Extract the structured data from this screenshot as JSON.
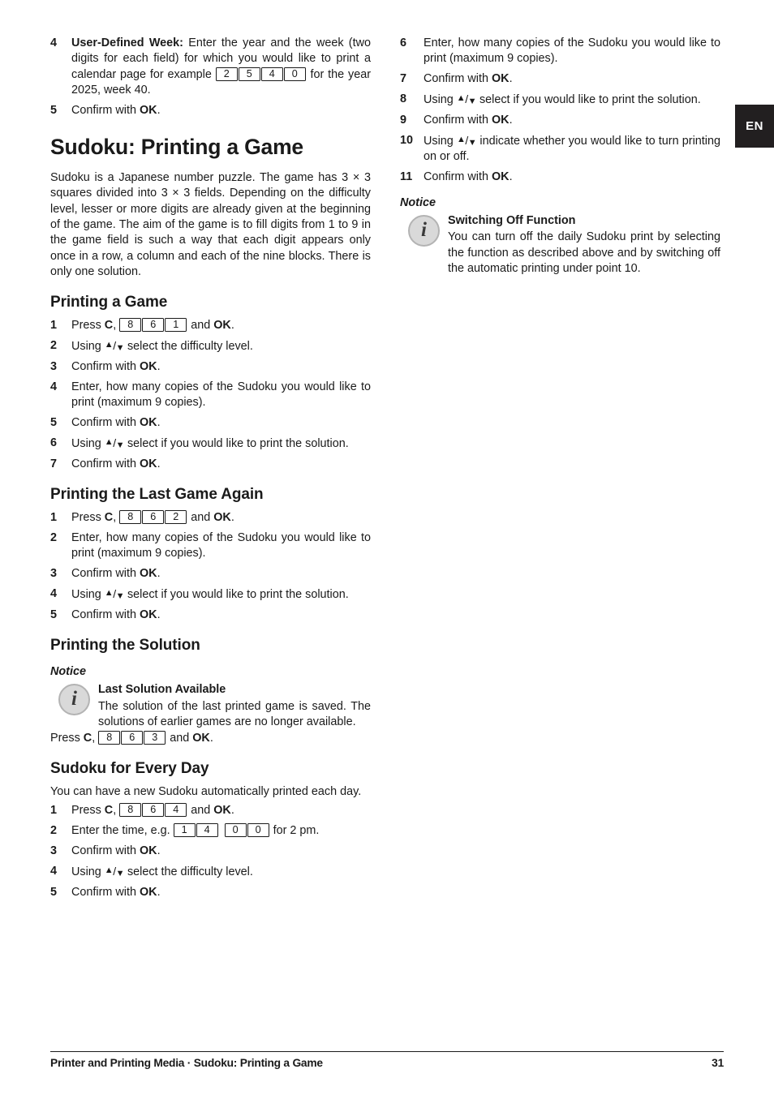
{
  "language_tab": {
    "label": "EN"
  },
  "left_column": {
    "continued_steps": [
      {
        "num": "4",
        "lead": "User-Defined Week:",
        "text_before": " Enter the year and the week (two digits for each field) for which you would like to print a calendar page for example ",
        "keys": [
          "2",
          "5",
          "4",
          "0"
        ],
        "text_after": " for the year 2025, week 40."
      },
      {
        "num": "5",
        "text_before": "Confirm with ",
        "bold": "OK",
        "text_after": "."
      }
    ],
    "section_title": "Sudoku: Printing a Game",
    "intro": "Sudoku is a Japanese number puzzle. The game has 3 × 3 squares divided into 3 × 3 fields. Depending on the difficulty level, lesser or more digits are already given at the beginning of the game. The aim of the game is to fill digits from 1 to 9 in the game field is such a way that each digit appears only once in a row, a column and each of the nine blocks. There is only one solution.",
    "printing_a_game": {
      "title": "Printing a Game",
      "steps": [
        {
          "num": "1",
          "kind": "press",
          "text_before": "Press ",
          "key_c": "C",
          "comma": ", ",
          "keys": [
            "8",
            "6",
            "1"
          ],
          "mid": " and ",
          "bold": "OK",
          "text_after": "."
        },
        {
          "num": "2",
          "kind": "updown",
          "text_before": "Using ",
          "text_after": " select the difficulty level."
        },
        {
          "num": "3",
          "kind": "confirm",
          "text_before": "Confirm with ",
          "bold": "OK",
          "text_after": "."
        },
        {
          "num": "4",
          "kind": "plain",
          "text": "Enter, how many copies of the Sudoku you would like to print (maximum 9 copies)."
        },
        {
          "num": "5",
          "kind": "confirm",
          "text_before": "Confirm with ",
          "bold": "OK",
          "text_after": "."
        },
        {
          "num": "6",
          "kind": "updown",
          "text_before": "Using ",
          "text_after": " select if you would like to print the solution."
        },
        {
          "num": "7",
          "kind": "confirm",
          "text_before": "Confirm with ",
          "bold": "OK",
          "text_after": "."
        }
      ]
    },
    "printing_last_game": {
      "title": "Printing the Last Game Again",
      "steps": [
        {
          "num": "1",
          "kind": "press",
          "text_before": "Press ",
          "key_c": "C",
          "comma": ", ",
          "keys": [
            "8",
            "6",
            "2"
          ],
          "mid": " and ",
          "bold": "OK",
          "text_after": "."
        },
        {
          "num": "2",
          "kind": "plain",
          "text": "Enter, how many copies of the Sudoku you would like to print (maximum 9 copies)."
        },
        {
          "num": "3",
          "kind": "confirm",
          "text_before": "Confirm with ",
          "bold": "OK",
          "text_after": "."
        },
        {
          "num": "4",
          "kind": "updown",
          "text_before": "Using ",
          "text_after": " select if you would like to print the solution."
        },
        {
          "num": "5",
          "kind": "confirm",
          "text_before": "Confirm with ",
          "bold": "OK",
          "text_after": "."
        }
      ]
    },
    "printing_solution": {
      "title": "Printing the Solution",
      "notice_label": "Notice",
      "notice_icon": "info-icon",
      "notice_title": "Last Solution Available",
      "notice_text": "The solution of the last printed game is saved. The solutions of earlier games are no longer available.",
      "press_line": {
        "text_before": "Press ",
        "key_c": "C",
        "comma": ", ",
        "keys": [
          "8",
          "6",
          "3"
        ],
        "mid": " and ",
        "bold": "OK",
        "text_after": "."
      }
    },
    "sudoku_every_day": {
      "title": "Sudoku for Every Day",
      "intro": "You can have a new Sudoku automatically printed each day.",
      "steps": [
        {
          "num": "1",
          "kind": "press",
          "text_before": "Press ",
          "key_c": "C",
          "comma": ", ",
          "keys": [
            "8",
            "6",
            "4"
          ],
          "mid": " and ",
          "bold": "OK",
          "text_after": "."
        },
        {
          "num": "2",
          "kind": "time",
          "text_before": "Enter the time, e.g. ",
          "keys_a": [
            "1",
            "4"
          ],
          "keys_b": [
            "0",
            "0"
          ],
          "text_after": " for 2 pm."
        },
        {
          "num": "3",
          "kind": "confirm",
          "text_before": "Confirm with ",
          "bold": "OK",
          "text_after": "."
        },
        {
          "num": "4",
          "kind": "updown",
          "text_before": "Using ",
          "text_after": " select the difficulty level."
        },
        {
          "num": "5",
          "kind": "confirm",
          "text_before": "Confirm with ",
          "bold": "OK",
          "text_after": "."
        }
      ]
    }
  },
  "right_column": {
    "steps": [
      {
        "num": "6",
        "kind": "plain",
        "text": "Enter, how many copies of the Sudoku you would like to print (maximum 9 copies)."
      },
      {
        "num": "7",
        "kind": "confirm",
        "text_before": "Confirm with ",
        "bold": "OK",
        "text_after": "."
      },
      {
        "num": "8",
        "kind": "updown",
        "text_before": "Using ",
        "text_after": " select if you would like to print the solution."
      },
      {
        "num": "9",
        "kind": "confirm",
        "text_before": "Confirm with ",
        "bold": "OK",
        "text_after": "."
      },
      {
        "num": "10",
        "kind": "updown",
        "text_before": "Using ",
        "text_after": " indicate whether you would like to turn printing on or off."
      },
      {
        "num": "11",
        "kind": "confirm",
        "text_before": "Confirm with ",
        "bold": "OK",
        "text_after": "."
      }
    ],
    "notice_label": "Notice",
    "notice_icon": "info-icon",
    "notice_title": "Switching Off Function",
    "notice_text": "You can turn off the daily Sudoku print by selecting the function as described above and by switching off the automatic printing under point 10."
  },
  "footer": {
    "text": "Printer and Printing Media · Sudoku: Printing a Game",
    "page_number": "31"
  },
  "glyphs": {
    "arrow_up": "▲",
    "slash": "/",
    "arrow_down": "▼",
    "info_letter": "i"
  },
  "colors": {
    "text": "#1a1a1a",
    "tab_background": "#221f20",
    "tab_text": "#ffffff",
    "icon_fill": "#d9d9d9",
    "icon_ring": "#b3b3b3"
  }
}
